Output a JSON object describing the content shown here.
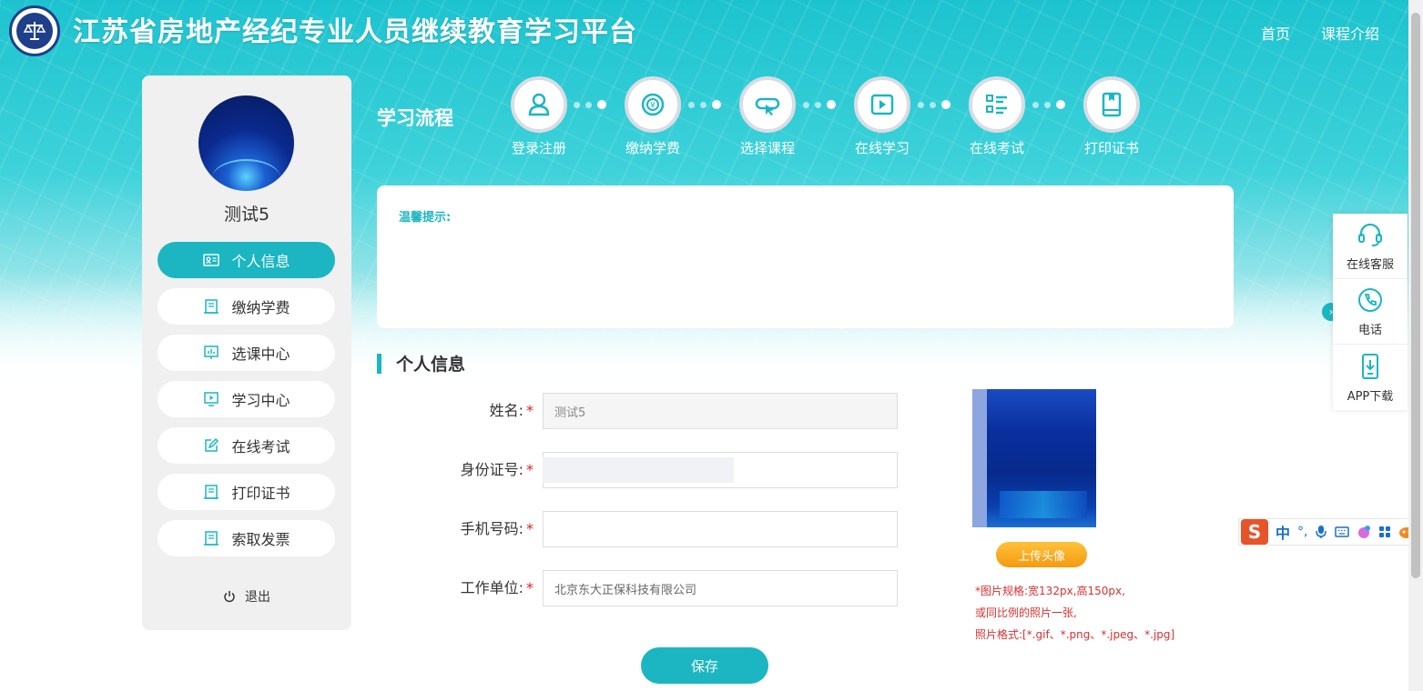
{
  "header": {
    "title": "江苏省房地产经纪专业人员继续教育学习平台",
    "nav": [
      "首页",
      "课程介绍"
    ]
  },
  "sidebar": {
    "username": "测试5",
    "items": [
      {
        "label": "个人信息",
        "icon": "id-card-icon",
        "active": true
      },
      {
        "label": "缴纳学费",
        "icon": "receipt-icon",
        "active": false
      },
      {
        "label": "选课中心",
        "icon": "presentation-icon",
        "active": false
      },
      {
        "label": "学习中心",
        "icon": "play-screen-icon",
        "active": false
      },
      {
        "label": "在线考试",
        "icon": "edit-icon",
        "active": false
      },
      {
        "label": "打印证书",
        "icon": "receipt-icon",
        "active": false
      },
      {
        "label": "索取发票",
        "icon": "receipt-icon",
        "active": false
      }
    ],
    "logout": "退出"
  },
  "flow": {
    "title": "学习流程",
    "steps": [
      {
        "label": "登录注册",
        "icon": "user-icon"
      },
      {
        "label": "缴纳学费",
        "icon": "coin-icon"
      },
      {
        "label": "选择课程",
        "icon": "select-icon"
      },
      {
        "label": "在线学习",
        "icon": "play-icon"
      },
      {
        "label": "在线考试",
        "icon": "list-icon"
      },
      {
        "label": "打印证书",
        "icon": "book-icon"
      }
    ]
  },
  "tips": {
    "title": "温馨提示:"
  },
  "profile": {
    "section_title": "个人信息",
    "fields": [
      {
        "label": "姓名:",
        "value": "测试5",
        "disabled": true
      },
      {
        "label": "身份证号:",
        "value": "",
        "disabled": false
      },
      {
        "label": "手机号码:",
        "value": "",
        "disabled": false
      },
      {
        "label": "工作单位:",
        "value": "北京东大正保科技有限公司",
        "disabled": false
      }
    ],
    "required_mark": "*",
    "upload_label": "上传头像",
    "photo_notes": [
      "*图片规格:宽132px,高150px,",
      "或同比例的照片一张,",
      "照片格式:[*.gif、*.png、*.jpeg、*.jpg]"
    ],
    "save_label": "保存"
  },
  "float_panel": {
    "items": [
      {
        "label": "在线客服",
        "icon": "headset-icon"
      },
      {
        "label": "电话",
        "icon": "phone-icon"
      },
      {
        "label": "APP下载",
        "icon": "mobile-download-icon"
      }
    ],
    "toggle": "›"
  },
  "ime": {
    "logo": "S",
    "mode": "中",
    "punct": "°,"
  },
  "colors": {
    "accent": "#1bb6c1",
    "warning": "#f5a623",
    "required": "#e02020"
  }
}
